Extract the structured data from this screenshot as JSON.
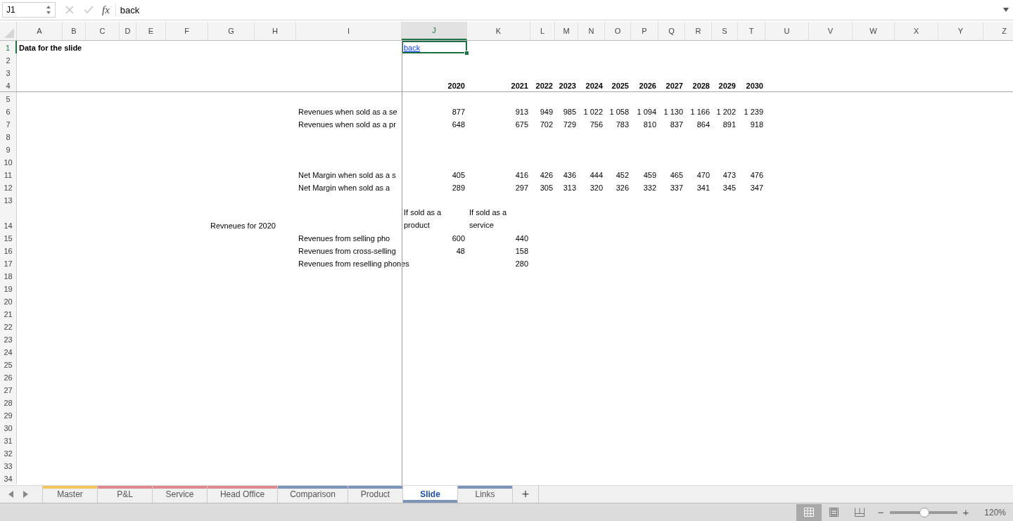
{
  "formula_bar": {
    "name_box": "J1",
    "function_label": "fx",
    "formula": "back"
  },
  "columns": [
    {
      "label": "A",
      "selected": false
    },
    {
      "label": "B",
      "selected": false
    },
    {
      "label": "C",
      "selected": false
    },
    {
      "label": "D",
      "selected": false
    },
    {
      "label": "E",
      "selected": false
    },
    {
      "label": "F",
      "selected": false
    },
    {
      "label": "G",
      "selected": false
    },
    {
      "label": "H",
      "selected": false
    },
    {
      "label": "I",
      "selected": false
    },
    {
      "label": "J",
      "selected": true
    },
    {
      "label": "K",
      "selected": false
    },
    {
      "label": "L",
      "selected": false
    },
    {
      "label": "M",
      "selected": false
    },
    {
      "label": "N",
      "selected": false
    },
    {
      "label": "O",
      "selected": false
    },
    {
      "label": "P",
      "selected": false
    },
    {
      "label": "Q",
      "selected": false
    },
    {
      "label": "R",
      "selected": false
    },
    {
      "label": "S",
      "selected": false
    },
    {
      "label": "T",
      "selected": false
    },
    {
      "label": "U",
      "selected": false
    },
    {
      "label": "V",
      "selected": false
    },
    {
      "label": "W",
      "selected": false
    },
    {
      "label": "X",
      "selected": false
    },
    {
      "label": "Y",
      "selected": false
    },
    {
      "label": "Z",
      "selected": false
    }
  ],
  "rows": [
    {
      "number": "1",
      "selected": true,
      "cells": {
        "A": {
          "kind": "label",
          "text": "Data for the slide",
          "bold": true,
          "selected": false
        },
        "J": {
          "kind": "link",
          "text": "back",
          "bold": false,
          "selected": true
        }
      }
    },
    {
      "number": "2",
      "selected": false
    },
    {
      "number": "3",
      "selected": false
    },
    {
      "number": "4",
      "selected": false,
      "cells": {
        "J": {
          "kind": "number",
          "text": "2020",
          "bold": true,
          "selected": false
        },
        "K": {
          "kind": "number",
          "text": "2021",
          "bold": true,
          "selected": false
        },
        "L": {
          "kind": "number",
          "text": "2022",
          "bold": true,
          "selected": false
        },
        "M": {
          "kind": "number",
          "text": "2023",
          "bold": true,
          "selected": false
        },
        "N": {
          "kind": "number",
          "text": "2024",
          "bold": true,
          "selected": false
        },
        "O": {
          "kind": "number",
          "text": "2025",
          "bold": true,
          "selected": false
        },
        "P": {
          "kind": "number",
          "text": "2026",
          "bold": true,
          "selected": false
        },
        "Q": {
          "kind": "number",
          "text": "2027",
          "bold": true,
          "selected": false
        },
        "R": {
          "kind": "number",
          "text": "2028",
          "bold": true,
          "selected": false
        },
        "S": {
          "kind": "number",
          "text": "2029",
          "bold": true,
          "selected": false
        },
        "T": {
          "kind": "number",
          "text": "2030",
          "bold": true,
          "selected": false
        }
      }
    },
    {
      "number": "5",
      "selected": false
    },
    {
      "number": "6",
      "selected": false,
      "cells": {
        "I": {
          "kind": "label",
          "text": "Revenues when sold as a se",
          "bold": false,
          "selected": false
        },
        "J": {
          "kind": "number",
          "text": "877",
          "bold": false,
          "selected": false
        },
        "K": {
          "kind": "number",
          "text": "913",
          "bold": false,
          "selected": false
        },
        "L": {
          "kind": "number",
          "text": "949",
          "bold": false,
          "selected": false
        },
        "M": {
          "kind": "number",
          "text": "985",
          "bold": false,
          "selected": false
        },
        "N": {
          "kind": "number",
          "text": "1 022",
          "bold": false,
          "selected": false
        },
        "O": {
          "kind": "number",
          "text": "1 058",
          "bold": false,
          "selected": false
        },
        "P": {
          "kind": "number",
          "text": "1 094",
          "bold": false,
          "selected": false
        },
        "Q": {
          "kind": "number",
          "text": "1 130",
          "bold": false,
          "selected": false
        },
        "R": {
          "kind": "number",
          "text": "1 166",
          "bold": false,
          "selected": false
        },
        "S": {
          "kind": "number",
          "text": "1 202",
          "bold": false,
          "selected": false
        },
        "T": {
          "kind": "number",
          "text": "1 239",
          "bold": false,
          "selected": false
        }
      }
    },
    {
      "number": "7",
      "selected": false,
      "cells": {
        "I": {
          "kind": "label",
          "text": "Revenues when sold as a pr",
          "bold": false,
          "selected": false
        },
        "J": {
          "kind": "number",
          "text": "648",
          "bold": false,
          "selected": false
        },
        "K": {
          "kind": "number",
          "text": "675",
          "bold": false,
          "selected": false
        },
        "L": {
          "kind": "number",
          "text": "702",
          "bold": false,
          "selected": false
        },
        "M": {
          "kind": "number",
          "text": "729",
          "bold": false,
          "selected": false
        },
        "N": {
          "kind": "number",
          "text": "756",
          "bold": false,
          "selected": false
        },
        "O": {
          "kind": "number",
          "text": "783",
          "bold": false,
          "selected": false
        },
        "P": {
          "kind": "number",
          "text": "810",
          "bold": false,
          "selected": false
        },
        "Q": {
          "kind": "number",
          "text": "837",
          "bold": false,
          "selected": false
        },
        "R": {
          "kind": "number",
          "text": "864",
          "bold": false,
          "selected": false
        },
        "S": {
          "kind": "number",
          "text": "891",
          "bold": false,
          "selected": false
        },
        "T": {
          "kind": "number",
          "text": "918",
          "bold": false,
          "selected": false
        }
      }
    },
    {
      "number": "8",
      "selected": false
    },
    {
      "number": "9",
      "selected": false
    },
    {
      "number": "10",
      "selected": false
    },
    {
      "number": "11",
      "selected": false,
      "cells": {
        "I": {
          "kind": "label",
          "text": "Net Margin when sold as a s",
          "bold": false,
          "selected": false
        },
        "J": {
          "kind": "number",
          "text": "405",
          "bold": false,
          "selected": false
        },
        "K": {
          "kind": "number",
          "text": "416",
          "bold": false,
          "selected": false
        },
        "L": {
          "kind": "number",
          "text": "426",
          "bold": false,
          "selected": false
        },
        "M": {
          "kind": "number",
          "text": "436",
          "bold": false,
          "selected": false
        },
        "N": {
          "kind": "number",
          "text": "444",
          "bold": false,
          "selected": false
        },
        "O": {
          "kind": "number",
          "text": "452",
          "bold": false,
          "selected": false
        },
        "P": {
          "kind": "number",
          "text": "459",
          "bold": false,
          "selected": false
        },
        "Q": {
          "kind": "number",
          "text": "465",
          "bold": false,
          "selected": false
        },
        "R": {
          "kind": "number",
          "text": "470",
          "bold": false,
          "selected": false
        },
        "S": {
          "kind": "number",
          "text": "473",
          "bold": false,
          "selected": false
        },
        "T": {
          "kind": "number",
          "text": "476",
          "bold": false,
          "selected": false
        }
      }
    },
    {
      "number": "12",
      "selected": false,
      "cells": {
        "I": {
          "kind": "label",
          "text": "Net Margin when sold as a",
          "bold": false,
          "selected": false
        },
        "J": {
          "kind": "number",
          "text": "289",
          "bold": false,
          "selected": false
        },
        "K": {
          "kind": "number",
          "text": "297",
          "bold": false,
          "selected": false
        },
        "L": {
          "kind": "number",
          "text": "305",
          "bold": false,
          "selected": false
        },
        "M": {
          "kind": "number",
          "text": "313",
          "bold": false,
          "selected": false
        },
        "N": {
          "kind": "number",
          "text": "320",
          "bold": false,
          "selected": false
        },
        "O": {
          "kind": "number",
          "text": "326",
          "bold": false,
          "selected": false
        },
        "P": {
          "kind": "number",
          "text": "332",
          "bold": false,
          "selected": false
        },
        "Q": {
          "kind": "number",
          "text": "337",
          "bold": false,
          "selected": false
        },
        "R": {
          "kind": "number",
          "text": "341",
          "bold": false,
          "selected": false
        },
        "S": {
          "kind": "number",
          "text": "345",
          "bold": false,
          "selected": false
        },
        "T": {
          "kind": "number",
          "text": "347",
          "bold": false,
          "selected": false
        }
      }
    },
    {
      "number": "13",
      "selected": false
    },
    {
      "number": "14",
      "selected": false,
      "cells": {
        "G": {
          "kind": "label",
          "text": "Revneues for 2020",
          "bold": false,
          "selected": false
        },
        "J": {
          "kind": "wrapped",
          "text": "If sold as a product",
          "bold": false,
          "selected": false
        },
        "K": {
          "kind": "wrapped",
          "text": "If sold as a service",
          "bold": false,
          "selected": false
        }
      }
    },
    {
      "number": "15",
      "selected": false,
      "cells": {
        "I": {
          "kind": "label",
          "text": " Revenues from selling pho",
          "bold": false,
          "selected": false
        },
        "J": {
          "kind": "number",
          "text": "600",
          "bold": false,
          "selected": false
        },
        "K": {
          "kind": "number",
          "text": "440",
          "bold": false,
          "selected": false
        }
      }
    },
    {
      "number": "16",
      "selected": false,
      "cells": {
        "I": {
          "kind": "label",
          "text": "Revenues from cross-selling",
          "bold": false,
          "selected": false
        },
        "J": {
          "kind": "number",
          "text": "48",
          "bold": false,
          "selected": false
        },
        "K": {
          "kind": "number",
          "text": "158",
          "bold": false,
          "selected": false
        }
      }
    },
    {
      "number": "17",
      "selected": false,
      "cells": {
        "I": {
          "kind": "label",
          "text": "Revenues from reselling phones",
          "bold": false,
          "selected": false
        },
        "K": {
          "kind": "number",
          "text": "280",
          "bold": false,
          "selected": false
        }
      }
    },
    {
      "number": "18",
      "selected": false
    },
    {
      "number": "19",
      "selected": false
    },
    {
      "number": "20",
      "selected": false
    },
    {
      "number": "21",
      "selected": false
    },
    {
      "number": "22",
      "selected": false
    },
    {
      "number": "23",
      "selected": false
    },
    {
      "number": "24",
      "selected": false
    },
    {
      "number": "25",
      "selected": false
    },
    {
      "number": "26",
      "selected": false
    },
    {
      "number": "27",
      "selected": false
    },
    {
      "number": "28",
      "selected": false
    },
    {
      "number": "29",
      "selected": false
    },
    {
      "number": "30",
      "selected": false
    },
    {
      "number": "31",
      "selected": false
    },
    {
      "number": "32",
      "selected": false
    },
    {
      "number": "33",
      "selected": false
    },
    {
      "number": "34",
      "selected": false
    }
  ],
  "sheet_tabs": [
    {
      "label": "Master",
      "color": "#f2c75c",
      "selected": false
    },
    {
      "label": "P&L",
      "color": "#e0898e",
      "selected": false
    },
    {
      "label": "Service",
      "color": "#e0898e",
      "selected": false
    },
    {
      "label": "Head Office",
      "color": "#e0898e",
      "selected": false
    },
    {
      "label": "Comparison",
      "color": "#7d93b8",
      "selected": false
    },
    {
      "label": "Product",
      "color": "#7d93b8",
      "selected": false
    },
    {
      "label": "Slide",
      "color": "#7d93b8",
      "selected": true
    },
    {
      "label": "Links",
      "color": "#7d93b8",
      "selected": false
    }
  ],
  "add_sheet": "+",
  "status_bar": {
    "views": [
      {
        "kind": "normal",
        "selected": true
      },
      {
        "kind": "page_layout",
        "selected": false
      },
      {
        "kind": "page_break",
        "selected": false
      }
    ],
    "zoom_minus": "−",
    "zoom_plus": "+",
    "zoom": {
      "level": 0.52
    },
    "zoom_label": "120%"
  }
}
